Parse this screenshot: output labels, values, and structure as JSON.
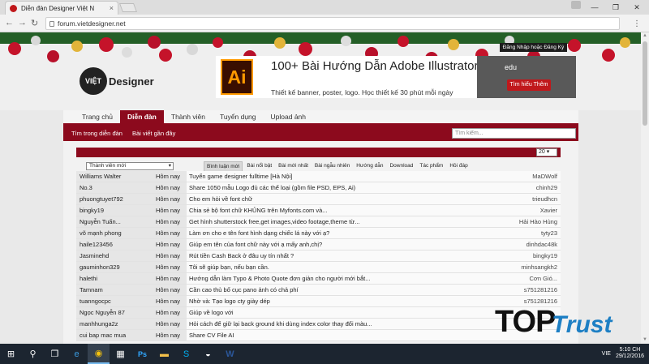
{
  "browser": {
    "tab_title": "Diễn đàn Designer Việt N",
    "tab_close": "×",
    "url": "forum.vietdesigner.net",
    "window_controls": [
      "—",
      "❐",
      "✕"
    ]
  },
  "site": {
    "logo_ball": "VIỆT",
    "logo_text": "Designer",
    "login_label": "Đăng Nhập hoặc Đăng Ký"
  },
  "ad": {
    "icon_text": "Ai",
    "title": "100+ Bài Hướng Dẫn Adobe Illustrator Hay Nhất",
    "subtitle": "Thiết kế banner, poster, logo. Học thiết kế 30 phút mỗi ngày",
    "brand": "edu",
    "cta": "Tìm hiểu Thêm"
  },
  "nav": {
    "items": [
      "Trang chủ",
      "Diễn đàn",
      "Thành viên",
      "Tuyển dụng",
      "Upload ảnh"
    ],
    "active_index": 1
  },
  "subnav": {
    "search_forum": "Tìm trong diễn đàn",
    "recent_posts": "Bài viết gần đây",
    "search_placeholder": "Tìm kiếm..."
  },
  "list": {
    "per_page": "20",
    "member_filter": "Thành viên mới",
    "tabs": [
      "Bình luận mới",
      "Bài nổi bật",
      "Bài mới nhất",
      "Bài ngẫu nhiên",
      "Hướng dẫn",
      "Download",
      "Tác phẩm",
      "Hỏi đáp"
    ],
    "active_tab": 0,
    "rows": [
      {
        "user": "Williams Walter",
        "time": "Hôm nay",
        "title": "Tuyển game designer fulltime [Hà Nội]",
        "author": "MaDWolf"
      },
      {
        "user": "No.3",
        "time": "Hôm nay",
        "title": "Share 1050 mẫu Logo đủ các thể loại (gồm file PSD, EPS, Ai)",
        "author": "chinh29"
      },
      {
        "user": "phuongtuyet792",
        "time": "Hôm nay",
        "title": "Cho em hỏi về font chữ",
        "author": "trieudhcn"
      },
      {
        "user": "bingky19",
        "time": "Hôm nay",
        "title": "Chia sẻ bộ font chữ KHỦNG trên Myfonts.com và...",
        "author": "Xavier"
      },
      {
        "user": "Nguyễn Tuấn...",
        "time": "Hôm nay",
        "title": "Get hình shutterstock free,get images,video footage,theme từ...",
        "author": "Hải Hào Hùng"
      },
      {
        "user": "võ mạnh phong",
        "time": "Hôm nay",
        "title": "Làm ơn cho e tên font hình dạng chiếc lá này với ạ?",
        "author": "tyty23"
      },
      {
        "user": "haile123456",
        "time": "Hôm nay",
        "title": "Giúp em tên của font chữ này với ạ mấy anh,chị?",
        "author": "dinhdac48k"
      },
      {
        "user": "Jasminehd",
        "time": "Hôm nay",
        "title": "Rút tiền Cash Back ở đâu uy tín nhất ?",
        "author": "bingky19"
      },
      {
        "user": "gauminhon329",
        "time": "Hôm nay",
        "title": "Tôi sẽ giúp bạn, nếu bạn cần.",
        "author": "minhsangkh2"
      },
      {
        "user": "halethi",
        "time": "Hôm nay",
        "title": "Hướng dẫn làm Typo & Photo Quote đơn giản cho người mới bắt...",
        "author": "Cơn Gió..."
      },
      {
        "user": "Tamnam",
        "time": "Hôm nay",
        "title": "Cần cao thủ bố cục pano ảnh có chả phí",
        "author": "s751281216"
      },
      {
        "user": "tuanngocpc",
        "time": "Hôm nay",
        "title": "Nhờ và: Tạo logo cty giày dép",
        "author": "s751281216"
      },
      {
        "user": "Ngọc Nguyễn 87",
        "time": "Hôm nay",
        "title": "Giúp về logo với",
        "author": ""
      },
      {
        "user": "manhhunga2z",
        "time": "Hôm nay",
        "title": "Hỏi cách để giữ lại back ground khi dùng index color thay đổi màu...",
        "author": ""
      },
      {
        "user": "cui bap mac mua",
        "time": "Hôm nay",
        "title": "Share CV File AI",
        "author": ""
      }
    ]
  },
  "watermark": {
    "top": "TOP",
    "trust": "Trust"
  },
  "taskbar": {
    "lang": "VIE",
    "time": "5:10 CH",
    "date": "29/12/2016"
  },
  "colors": {
    "brand_red": "#8c0a1d",
    "garland_green": "#245f27"
  }
}
